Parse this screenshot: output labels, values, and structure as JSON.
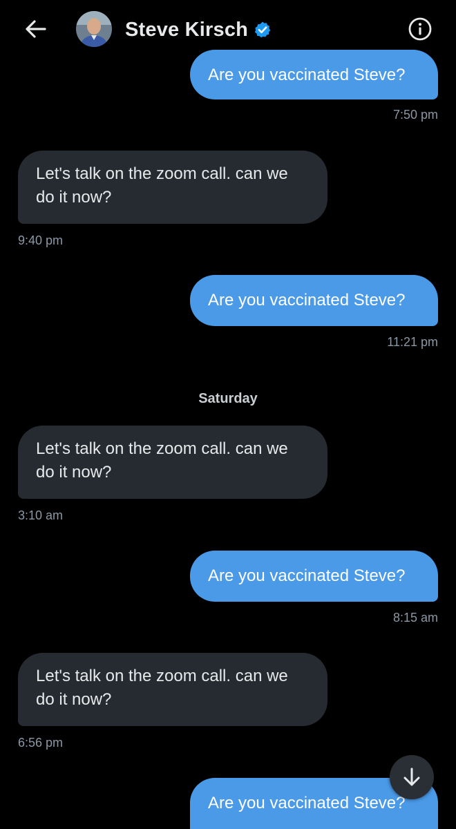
{
  "header": {
    "back_icon": "arrow-left-icon",
    "contact_name": "Steve Kirsch",
    "verified_icon": "verified-badge-icon",
    "info_icon": "info-icon"
  },
  "colors": {
    "outgoing_bubble": "#4a9ae8",
    "incoming_bubble": "#262b31",
    "background": "#000000",
    "timestamp": "#8b98a5",
    "verified": "#1d9bf0"
  },
  "conversation": {
    "messages": [
      {
        "direction": "outgoing",
        "text": "Are you vaccinated Steve?",
        "time": "7:50 pm"
      },
      {
        "direction": "incoming",
        "text": "Let's talk on the zoom call. can we do it now?",
        "time": "9:40 pm"
      },
      {
        "direction": "outgoing",
        "text": "Are you vaccinated Steve?",
        "time": "11:21 pm"
      },
      {
        "direction": "incoming",
        "text": "Let's talk on the zoom call. can we do it now?",
        "time": "3:10 am"
      },
      {
        "direction": "outgoing",
        "text": "Are you vaccinated Steve?",
        "time": "8:15 am"
      },
      {
        "direction": "incoming",
        "text": "Let's talk on the zoom call. can we do it now?",
        "time": "6:56 pm"
      },
      {
        "direction": "outgoing",
        "text": "Are you vaccinated Steve?"
      }
    ],
    "day_separator": "Saturday"
  },
  "scroll_button_icon": "arrow-down-icon"
}
